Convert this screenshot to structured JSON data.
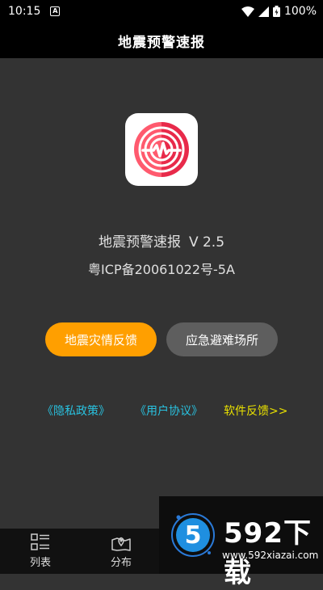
{
  "status_bar": {
    "time": "10:15",
    "notification_icon": "A",
    "battery_percent": "100%"
  },
  "header": {
    "title": "地震预警速报"
  },
  "about": {
    "app_name": "地震预警速报",
    "version": "V 2.5",
    "icp": "粤ICP备20061022号-5A"
  },
  "buttons": {
    "feedback": "地震灾情反馈",
    "shelter": "应急避难场所"
  },
  "links": {
    "privacy": "《隐私政策》",
    "agreement": "《用户协议》",
    "software_feedback": "软件反馈>>"
  },
  "bottom_nav": {
    "items": [
      {
        "label": "列表",
        "icon": "list-icon"
      },
      {
        "label": "分布",
        "icon": "map-icon"
      }
    ]
  },
  "watermark": {
    "logo_digit": "5",
    "brand": "592下载",
    "url": "www.592xiazai.com"
  },
  "colors": {
    "accent_orange": "#ff9f00",
    "link_cyan": "#29c2e0",
    "link_yellow": "#e8e000",
    "icon_red": "#ee2e55"
  }
}
